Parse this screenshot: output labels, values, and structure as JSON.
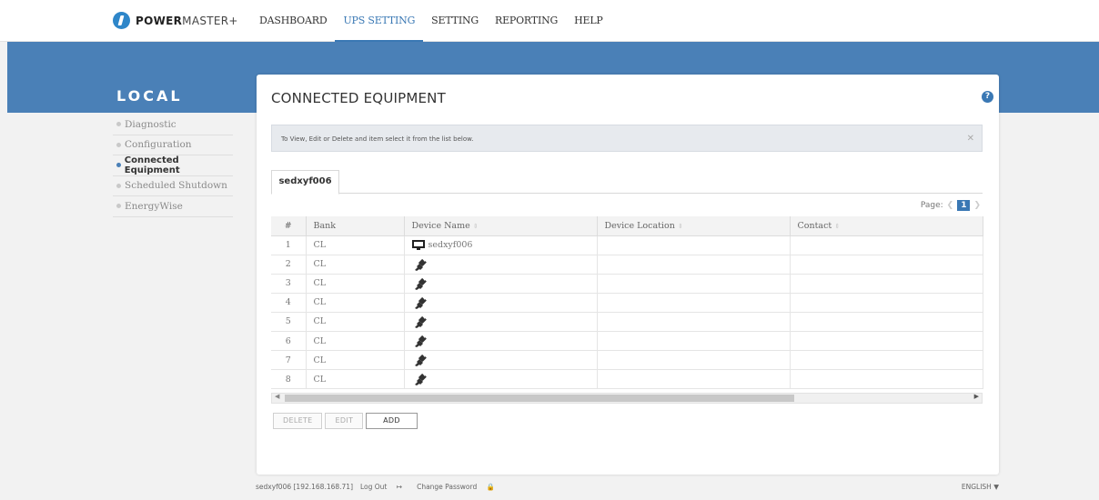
{
  "brand": {
    "bold": "POWER",
    "light": "MASTER+",
    "accent": "#2e86c9"
  },
  "nav": [
    "DASHBOARD",
    "UPS SETTING",
    "SETTING",
    "REPORTING",
    "HELP"
  ],
  "nav_active": "UPS SETTING",
  "sidebar": {
    "heading": "LOCAL",
    "items": [
      "Diagnostic",
      "Configuration",
      "Connected Equipment",
      "Scheduled Shutdown",
      "EnergyWise"
    ],
    "active": "Connected Equipment"
  },
  "panel": {
    "title": "CONNECTED EQUIPMENT",
    "help": "?",
    "info": "To View, Edit or Delete and item select it from the list below.",
    "info_close": "✕",
    "tab": "sedxyf006",
    "pager_label": "Page:",
    "pager_current": "1"
  },
  "table": {
    "headers": [
      "#",
      "Bank",
      "Device Name",
      "Device Location",
      "Contact"
    ],
    "sortable": [
      false,
      false,
      true,
      true,
      true
    ],
    "rows": [
      {
        "num": "1",
        "bank": "CL",
        "icon": "monitor-icon",
        "device": "sedxyf006",
        "location": "",
        "contact": ""
      },
      {
        "num": "2",
        "bank": "CL",
        "icon": "plug-icon",
        "device": "",
        "location": "",
        "contact": ""
      },
      {
        "num": "3",
        "bank": "CL",
        "icon": "plug-icon",
        "device": "",
        "location": "",
        "contact": ""
      },
      {
        "num": "4",
        "bank": "CL",
        "icon": "plug-icon",
        "device": "",
        "location": "",
        "contact": ""
      },
      {
        "num": "5",
        "bank": "CL",
        "icon": "plug-icon",
        "device": "",
        "location": "",
        "contact": ""
      },
      {
        "num": "6",
        "bank": "CL",
        "icon": "plug-icon",
        "device": "",
        "location": "",
        "contact": ""
      },
      {
        "num": "7",
        "bank": "CL",
        "icon": "plug-icon",
        "device": "",
        "location": "",
        "contact": ""
      },
      {
        "num": "8",
        "bank": "CL",
        "icon": "plug-icon",
        "device": "",
        "location": "",
        "contact": ""
      }
    ]
  },
  "buttons": {
    "delete": "DELETE",
    "edit": "EDIT",
    "add": "ADD"
  },
  "footer": {
    "user": "sedxyf006 [192.168.168.71]",
    "logout": "Log Out",
    "change_password": "Change Password",
    "language": "ENGLISH"
  }
}
